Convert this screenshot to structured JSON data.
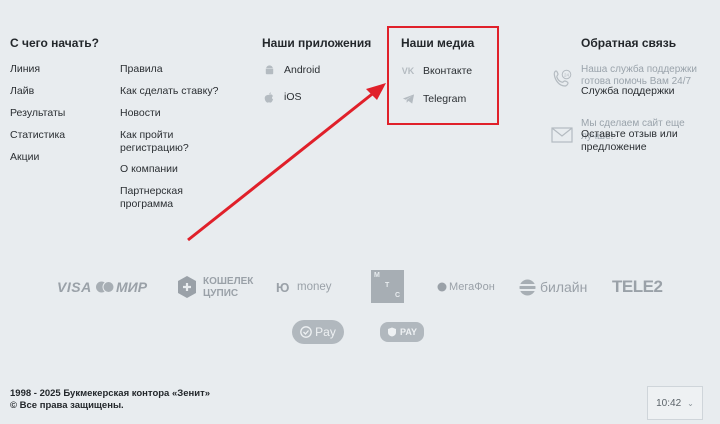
{
  "start": {
    "title": "С чего начать?",
    "col1": [
      "Линия",
      "Лайв",
      "Результаты",
      "Статистика",
      "Акции"
    ],
    "col2": [
      "Правила",
      "Как сделать ставку?",
      "Новости",
      "Как пройти регистрацию?",
      "О компании",
      "Партнерская программа"
    ]
  },
  "apps": {
    "title": "Наши приложения",
    "items": [
      "Android",
      "iOS"
    ]
  },
  "media": {
    "title": "Наши медиа",
    "items": [
      "Вконтакте",
      "Telegram"
    ]
  },
  "feedback": {
    "title": "Обратная связь",
    "support_note": "Наша служба поддержки готова помочь Вам 24/7",
    "support_link": "Служба поддержки",
    "improve_note": "Мы сделаем сайт еще лучше!",
    "improve_link": "Оставьте отзыв или предложение"
  },
  "payments": {
    "visa": "VISA",
    "mir": "МИР",
    "koshelek_1": "КОШЕЛЕК",
    "koshelek_2": "ЦУПИС",
    "umoney": "money",
    "mts_m": "М",
    "mts_t": "Т",
    "mts_s": "С",
    "megafon": "МегаФон",
    "beeline": "билайн",
    "tele2": "TELE2",
    "gpay": "Pay",
    "spay": "PAY"
  },
  "footer": {
    "copyright_1": "1998 - 2025 Букмекерская контора «Зенит»",
    "copyright_2": "© Все права защищены."
  },
  "clock": {
    "time": "10:42"
  },
  "colors": {
    "annotation": "#e0202a",
    "background": "#e8ecef",
    "muted": "#9aa3ab"
  }
}
